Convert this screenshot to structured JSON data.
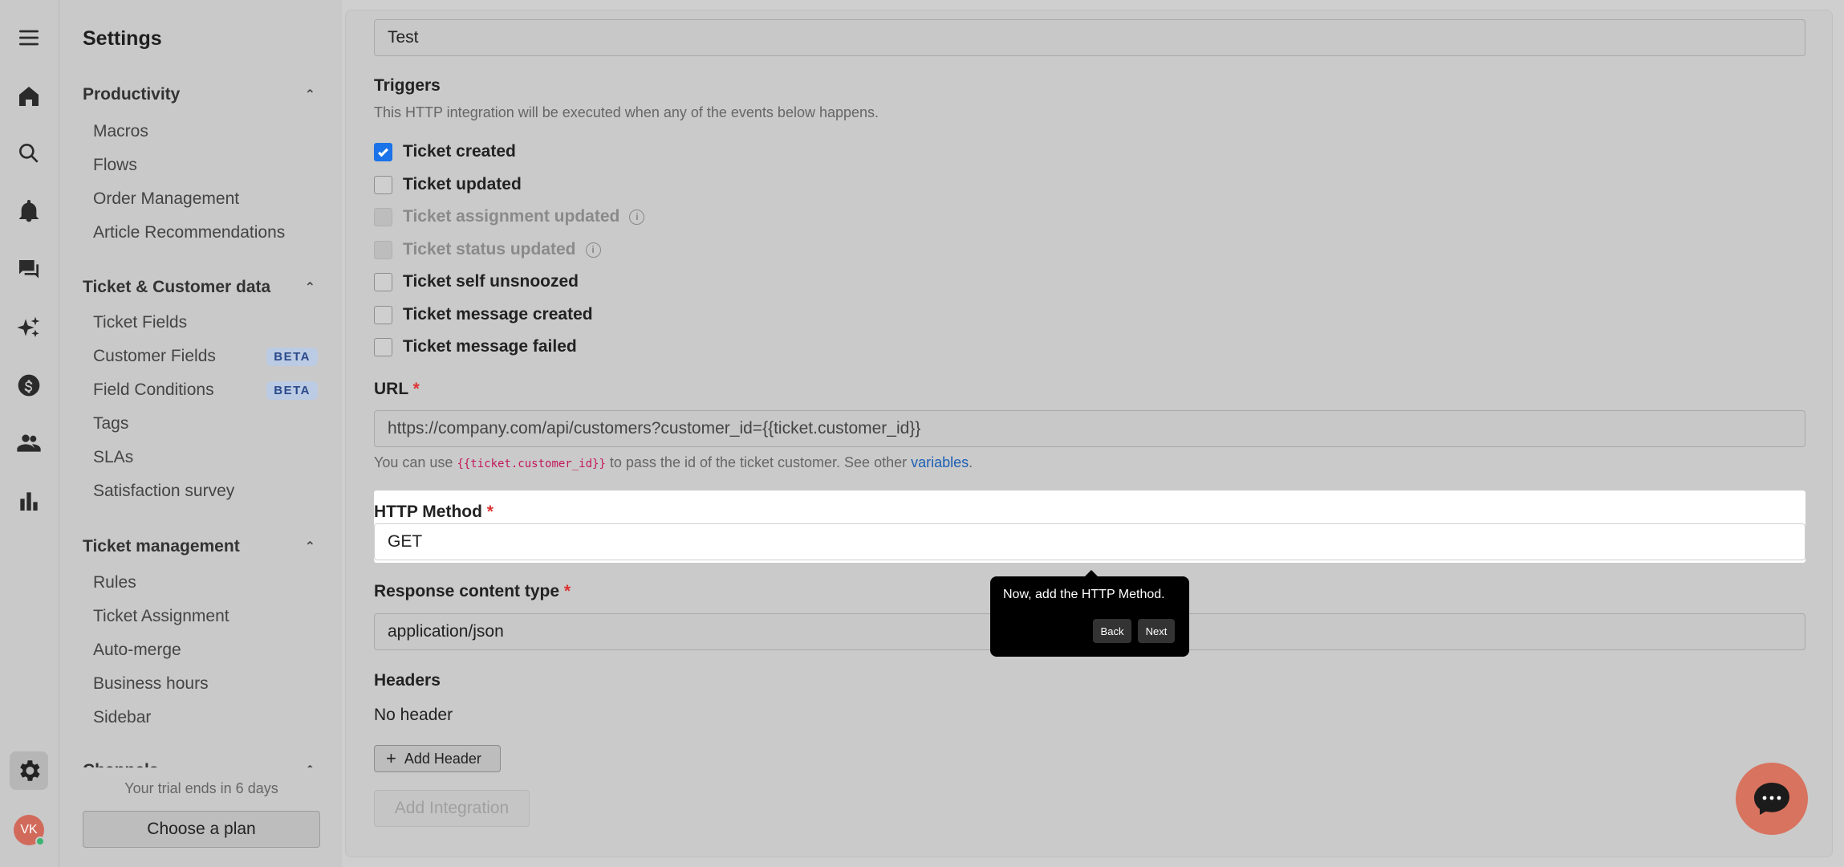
{
  "sidebar": {
    "title": "Settings",
    "sections": [
      {
        "label": "Productivity",
        "items": [
          {
            "label": "Macros"
          },
          {
            "label": "Flows"
          },
          {
            "label": "Order Management"
          },
          {
            "label": "Article Recommendations"
          }
        ]
      },
      {
        "label": "Ticket & Customer data",
        "items": [
          {
            "label": "Ticket Fields"
          },
          {
            "label": "Customer Fields",
            "badge": "BETA"
          },
          {
            "label": "Field Conditions",
            "badge": "BETA"
          },
          {
            "label": "Tags"
          },
          {
            "label": "SLAs"
          },
          {
            "label": "Satisfaction survey"
          }
        ]
      },
      {
        "label": "Ticket management",
        "items": [
          {
            "label": "Rules"
          },
          {
            "label": "Ticket Assignment"
          },
          {
            "label": "Auto-merge"
          },
          {
            "label": "Business hours"
          },
          {
            "label": "Sidebar"
          }
        ]
      },
      {
        "label": "Channels"
      }
    ],
    "trial_text": "Your trial ends in 6 days",
    "plan_button": "Choose a plan"
  },
  "user": {
    "initials": "VK"
  },
  "form": {
    "name_value": "Test",
    "triggers": {
      "title": "Triggers",
      "help": "This HTTP integration will be executed when any of the events below happens.",
      "items": [
        {
          "label": "Ticket created",
          "checked": true
        },
        {
          "label": "Ticket updated",
          "checked": false
        },
        {
          "label": "Ticket assignment updated",
          "checked": false,
          "disabled": true
        },
        {
          "label": "Ticket status updated",
          "checked": false,
          "disabled": true
        },
        {
          "label": "Ticket self unsnoozed",
          "checked": false
        },
        {
          "label": "Ticket message created",
          "checked": false
        },
        {
          "label": "Ticket message failed",
          "checked": false
        }
      ]
    },
    "url": {
      "label": "URL",
      "required_mark": "*",
      "value": "https://company.com/api/customers?customer_id={{ticket.customer_id}}",
      "help_prefix": "You can use",
      "help_code": "{{ticket.customer_id}}",
      "help_middle": "to pass the id of the ticket customer. See other",
      "help_link": "variables",
      "help_suffix": "."
    },
    "http_method": {
      "label": "HTTP Method",
      "required_mark": "*",
      "value": "GET"
    },
    "response_type": {
      "label": "Response content type",
      "required_mark": "*",
      "value": "application/json"
    },
    "headers": {
      "label": "Headers",
      "empty_text": "No header",
      "add_button": "Add Header"
    },
    "submit_button": "Add Integration"
  },
  "tooltip": {
    "text": "Now, add the HTTP Method.",
    "back": "Back",
    "next": "Next"
  },
  "colors": {
    "accent": "#1a73e8",
    "required": "#dd3333",
    "chat": "#d8735f"
  }
}
